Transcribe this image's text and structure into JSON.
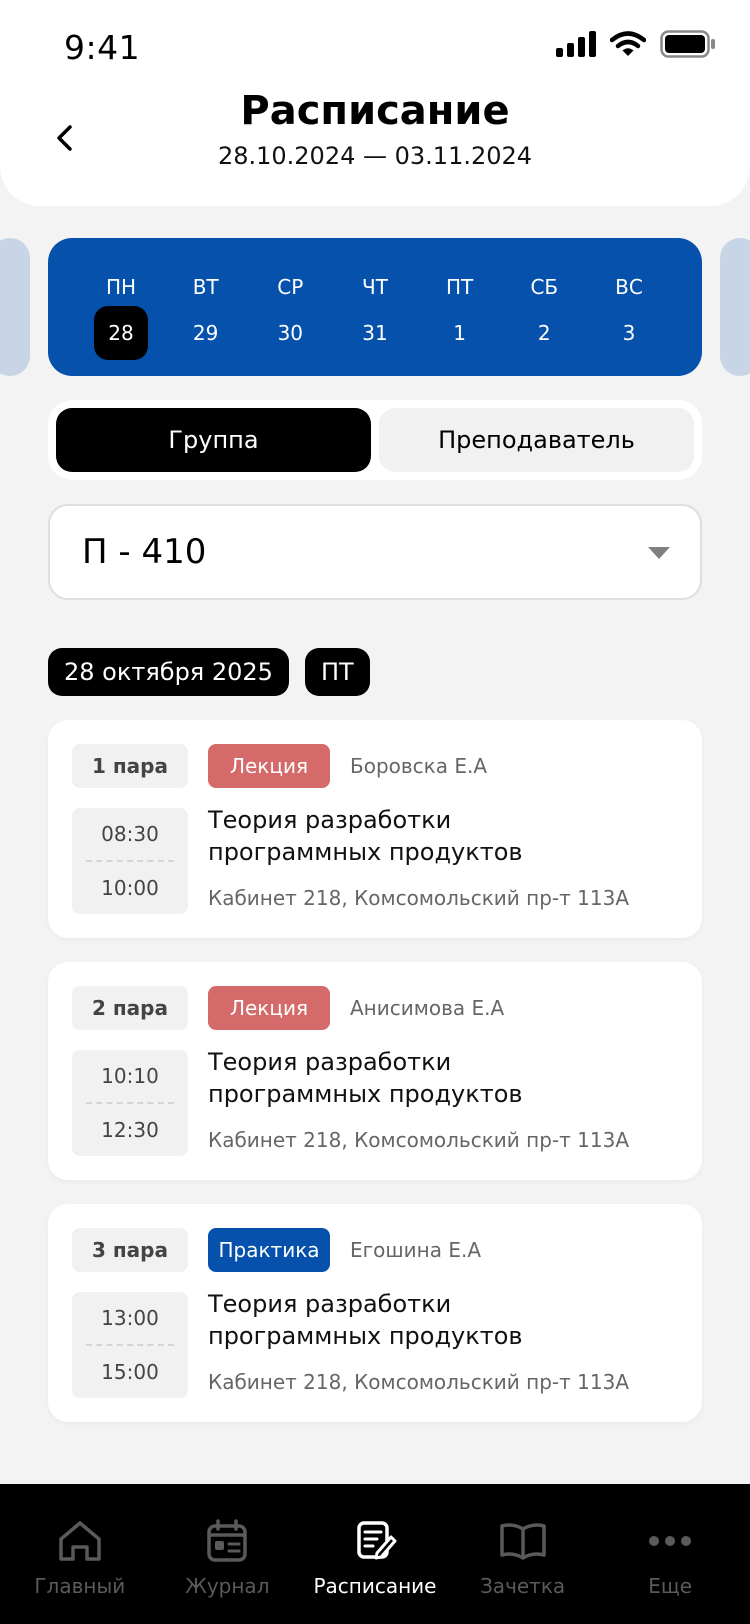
{
  "status_bar": {
    "time": "9:41"
  },
  "header": {
    "title": "Расписание",
    "date_range": "28.10.2024 — 03.11.2024"
  },
  "week": {
    "days": [
      {
        "name": "ПН",
        "num": "28",
        "active": true
      },
      {
        "name": "ВТ",
        "num": "29",
        "active": false
      },
      {
        "name": "СР",
        "num": "30",
        "active": false
      },
      {
        "name": "ЧТ",
        "num": "31",
        "active": false
      },
      {
        "name": "ПТ",
        "num": "1",
        "active": false
      },
      {
        "name": "СБ",
        "num": "2",
        "active": false
      },
      {
        "name": "ВС",
        "num": "3",
        "active": false
      }
    ]
  },
  "segment": {
    "group_label": "Группа",
    "teacher_label": "Преподаватель",
    "active": "group"
  },
  "group_select": {
    "value": "П - 410"
  },
  "date_chips": {
    "date": "28 октября 2025",
    "weekday": "ПТ"
  },
  "lessons": [
    {
      "pair": "1 пара",
      "type": "Лекция",
      "type_color": "#d46a6a",
      "teacher": "Боровска Е.А",
      "start": "08:30",
      "end": "10:00",
      "subject_line1": "Теория разработки",
      "subject_line2": "программных продуктов",
      "room": "Кабинет 218, Комсомольский пр-т 113А"
    },
    {
      "pair": "2 пара",
      "type": "Лекция",
      "type_color": "#d46a6a",
      "teacher": "Анисимова Е.А",
      "start": "10:10",
      "end": "12:30",
      "subject_line1": "Теория разработки",
      "subject_line2": "программных продуктов",
      "room": "Кабинет 218, Комсомольский пр-т 113А"
    },
    {
      "pair": "3 пара",
      "type": "Практика",
      "type_color": "#0551ac",
      "teacher": "Егошина Е.А",
      "start": "13:00",
      "end": "15:00",
      "subject_line1": "Теория разработки",
      "subject_line2": "программных продуктов",
      "room": "Кабинет 218, Комсомольский пр-т 113А"
    }
  ],
  "tab_bar": {
    "items": [
      {
        "label": "Главный",
        "icon": "home-icon",
        "active": false
      },
      {
        "label": "Журнал",
        "icon": "journal-icon",
        "active": false
      },
      {
        "label": "Расписание",
        "icon": "schedule-icon",
        "active": true
      },
      {
        "label": "Зачетка",
        "icon": "gradebook-icon",
        "active": false
      },
      {
        "label": "Еще",
        "icon": "more-icon",
        "active": false
      }
    ]
  },
  "colors": {
    "accent_blue": "#0551ac",
    "lecture_red": "#d46a6a",
    "background": "#f3f3f3"
  }
}
